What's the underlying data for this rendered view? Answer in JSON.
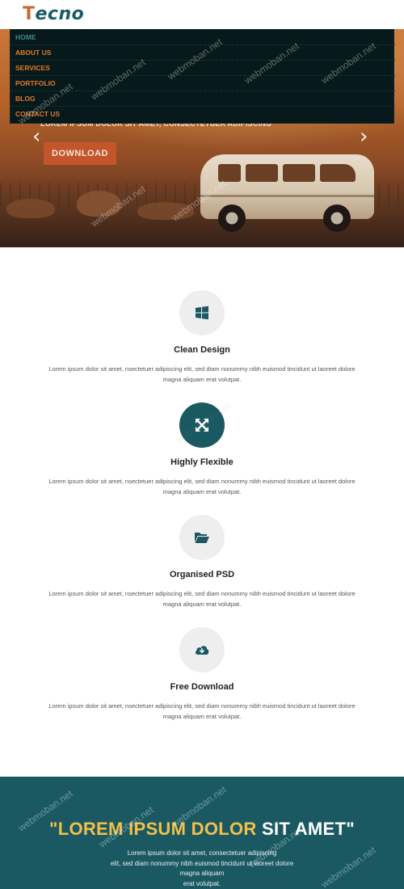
{
  "brand": {
    "first_letter": "T",
    "rest": "ecno"
  },
  "nav": {
    "items": [
      {
        "label": "HOME",
        "active": true
      },
      {
        "label": "ABOUT US",
        "active": false
      },
      {
        "label": "SERVICES",
        "active": false
      },
      {
        "label": "PORTFOLIO",
        "active": false
      },
      {
        "label": "BLOG",
        "active": false
      },
      {
        "label": "CONTACT US",
        "active": false
      }
    ]
  },
  "hero": {
    "text": "LOREM IPSUM DOLOR SIT AMET, CONSECTETUER ADIPISCING",
    "button": "DOWNLOAD",
    "prev": "‹",
    "next": "›"
  },
  "features": [
    {
      "icon": "windows-icon",
      "title": "Clean Design",
      "dark": false,
      "line1": "Lorem ipsum dolor sit amet, nsectetuer adipiscing elit, sed diam nonummy nibh euismod tincidunt ut laoreet dolore",
      "line2": "magna aliquam erat volutpat."
    },
    {
      "icon": "expand-icon",
      "title": "Highly Flexible",
      "dark": true,
      "line1": "Lorem ipsum dolor sit amet, nsectetuer adipiscing elit, sed diam nonummy nibh euismod tincidunt ut laoreet dolore",
      "line2": "magna aliquam erat volutpat."
    },
    {
      "icon": "folder-open-icon",
      "title": "Organised PSD",
      "dark": false,
      "line1": "Lorem ipsum dolor sit amet, nsectetuer adipiscing elit, sed diam nonummy nibh euismod tincidunt ut laoreet dolore",
      "line2": "magna aliquam erat volutpat."
    },
    {
      "icon": "cloud-download-icon",
      "title": "Free Download",
      "dark": false,
      "line1": "Lorem ipsum dolor sit amet, nsectetuer adipiscing elit, sed diam nonummy nibh euismod tincidunt ut laoreet dolore",
      "line2": "magna aliquam erat volutpat."
    }
  ],
  "banner": {
    "quote_open": "\"",
    "highlight": "LOREM IPSUM DOLOR",
    "rest": " SIT AMET\"",
    "line1": "Lorem ipsum dolor sit amet, consectetuer adipiscing",
    "line2": "elit, sed diam nonummy nibh euismod tincidunt ut laoreet dolore magna aliquam",
    "line3": "erat volutpat."
  },
  "watermark": "webmoban.net",
  "colors": {
    "teal": "#1b5962",
    "orange": "#c2552b",
    "nav_orange": "#e07a2a",
    "yellow": "#f2c04a"
  }
}
